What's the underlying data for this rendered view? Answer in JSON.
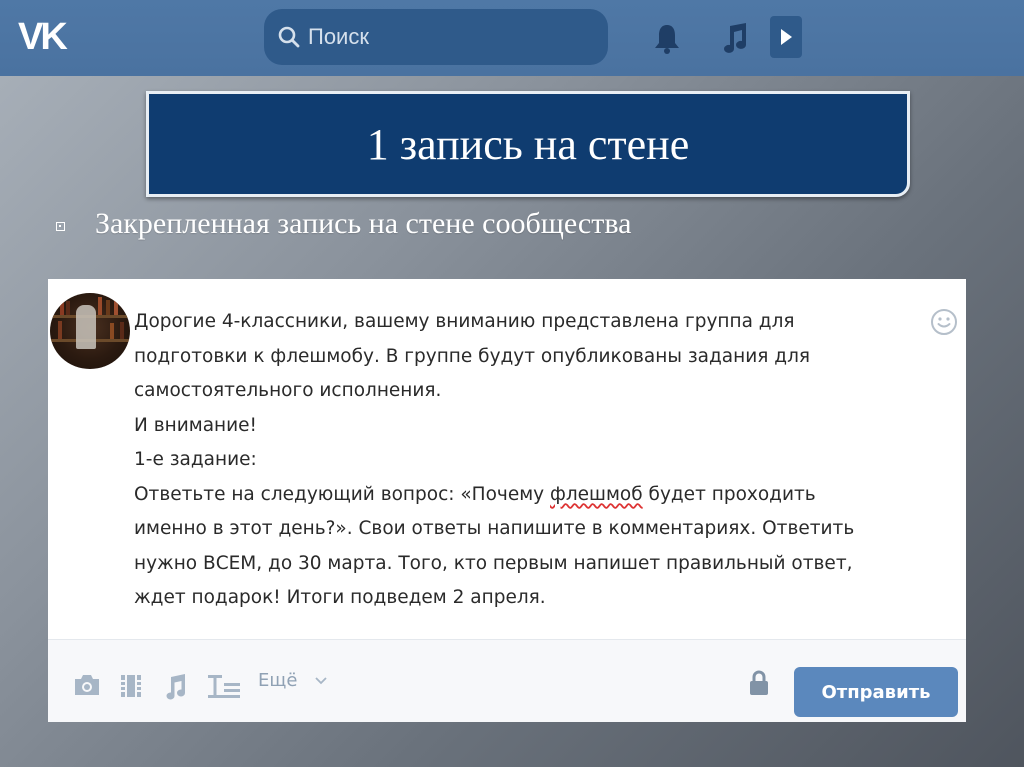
{
  "topbar": {
    "logo": "VK",
    "search_placeholder": "Поиск"
  },
  "slide": {
    "title": "1 запись на стене",
    "bullet": "Закрепленная запись на стене сообщества"
  },
  "post": {
    "lines": [
      "Дорогие 4-классники, вашему вниманию представлена группа для",
      "подготовки к флешмобу. В группе будут опубликованы задания для",
      "самостоятельного исполнения.",
      "И внимание!",
      "1-е задание:"
    ],
    "q_before": "Ответьте на следующий вопрос: «Почему ",
    "q_marked": "флешмоб",
    "q_after": " будет проходить",
    "lines2": [
      "именно в этот день?». Свои ответы напишите в комментариях. Ответить",
      "нужно ВСЕМ, до 30 марта. Того, кто первым напишет правильный ответ,",
      "ждет подарок! Итоги подведем 2 апреля."
    ],
    "more_label": "Ещё",
    "send_label": "Отправить"
  },
  "colors": {
    "topbar": "#4a72a0",
    "title_box": "#0f3c70",
    "send_button": "#5b88bd",
    "footer_icons": "#a7b6c6"
  },
  "icons": [
    "search-icon",
    "bell-icon",
    "music-icon",
    "play-icon",
    "smile-icon",
    "camera-icon",
    "video-icon",
    "audio-icon",
    "text-format-icon",
    "chevron-down-icon",
    "lock-icon"
  ]
}
